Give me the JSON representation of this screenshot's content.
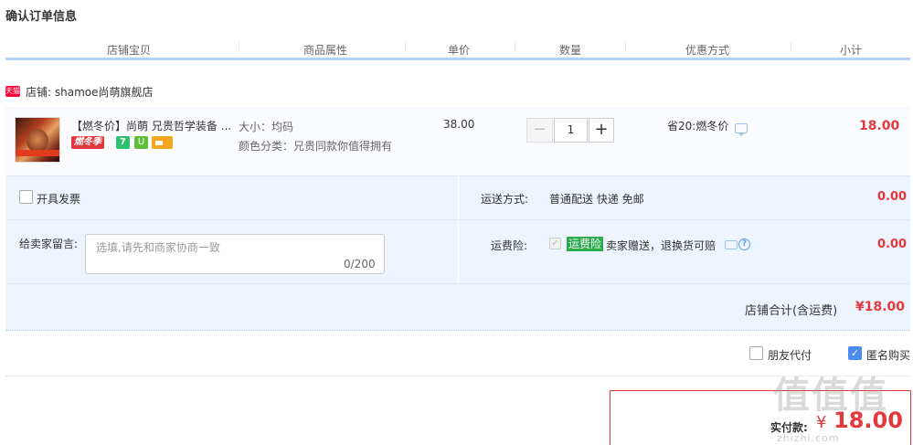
{
  "page": {
    "title": "确认订单信息"
  },
  "columns": [
    "店铺宝贝",
    "商品属性",
    "单价",
    "数量",
    "优惠方式",
    "小计"
  ],
  "shop": {
    "icon_text": "天猫",
    "label": "店铺: shamoe尚萌旗舰店"
  },
  "item": {
    "title": "【燃冬价】尚萌 兄贵哲学装备 ...",
    "promo_badge": "燃冬季",
    "badge_7": "7",
    "badge_shield": "U",
    "attr_size": "大小：均码",
    "attr_color": "颜色分类：兄贵同款你值得拥有",
    "unit_price": "38.00",
    "quantity": "1",
    "qty_minus": "−",
    "qty_plus": "+",
    "discount": "省20:燃冬价",
    "subtotal": "18.00"
  },
  "invoice": {
    "label": "开具发票"
  },
  "shipping": {
    "label": "运送方式:",
    "value": "普通配送 快递 免邮",
    "fee": "0.00"
  },
  "message": {
    "label": "给卖家留言:",
    "placeholder": "选填,请先和商家协商一致",
    "count": "0/200"
  },
  "insurance": {
    "label": "运费险:",
    "check": "✓",
    "tag": "运费险",
    "text": "卖家赠送，退换货可赔",
    "help": "?",
    "fee": "0.00"
  },
  "shop_total": {
    "label": "店铺合计(含运费)",
    "value": "¥18.00"
  },
  "options": {
    "friend_pay": "朋友代付",
    "anonymous": "匿名购买",
    "anon_check": "✓"
  },
  "payment": {
    "label": "实付款:",
    "currency": "¥",
    "value": "18.00"
  },
  "watermark": {
    "main": "值值值",
    "sub": "zhizhi.com"
  },
  "colors": {
    "accent_red": "#e4393c",
    "header_rule": "#b2d1ff",
    "panel_bg": "#eef4fd"
  }
}
